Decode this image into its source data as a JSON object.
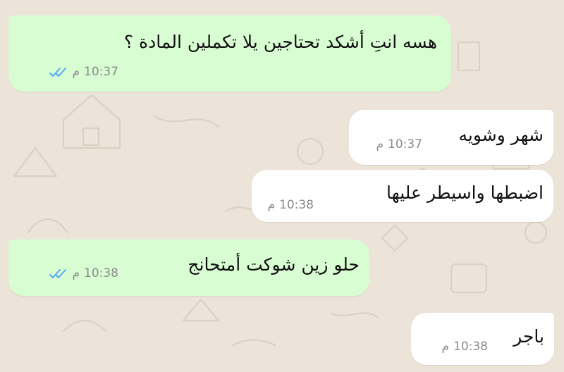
{
  "messages": [
    {
      "direction": "outgoing",
      "text": "هسه انتِ أشكد تحتاجين يلا تكملين المادة ؟",
      "time": "10:37",
      "ampm": "م",
      "status_icon": "double-check-read-icon"
    },
    {
      "direction": "incoming",
      "text": "شهر وشويه",
      "time": "10:37",
      "ampm": "م"
    },
    {
      "direction": "incoming",
      "text": "اضبطها واسيطر عليها",
      "time": "10:38",
      "ampm": "م"
    },
    {
      "direction": "outgoing",
      "text": "حلو زين شوكت أمتحانج",
      "time": "10:38",
      "ampm": "م",
      "status_icon": "double-check-read-icon"
    },
    {
      "direction": "incoming",
      "text": "باجر",
      "time": "10:38",
      "ampm": "م"
    }
  ],
  "colors": {
    "background": "#ece4d9",
    "outgoing_bubble": "#d9fdd3",
    "incoming_bubble": "#ffffff",
    "read_ticks": "#53a6f5",
    "meta_text": "#8a8a8a"
  }
}
